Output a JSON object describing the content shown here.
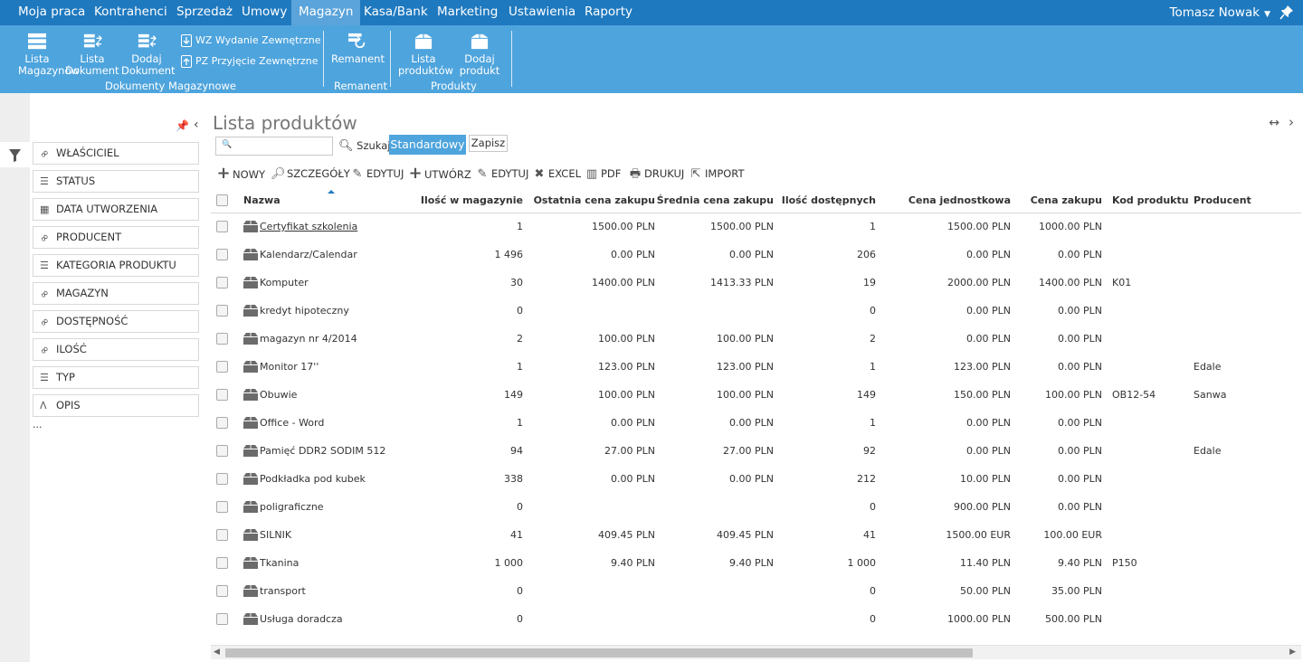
{
  "topnav": {
    "items": [
      "Moja praca",
      "Kontrahenci",
      "Sprzedaż",
      "Umowy",
      "Magazyn",
      "Kasa/Bank",
      "Marketing",
      "Ustawienia",
      "Raporty"
    ],
    "active": "Magazyn",
    "user": "Tomasz Nowak"
  },
  "ribbon": {
    "lista_magazynow": "Lista Magazynów",
    "lista_dokumentow": "Lista Dokumentó",
    "dodaj_dokument": "Dodaj Dokument",
    "wz": "WZ Wydanie Zewnętrzne",
    "pz": "PZ Przyjęcie Zewnętrzne",
    "group_dokumenty": "Dokumenty Magazynowe",
    "remanent_btn": "Remanent",
    "group_remanent": "Remanent",
    "lista_produktow": "Lista produktów",
    "dodaj_produkt": "Dodaj produkt",
    "group_produkty": "Produkty"
  },
  "filters": {
    "items": [
      {
        "label": "WŁAŚCICIEL",
        "icon": "link-icon"
      },
      {
        "label": "STATUS",
        "icon": "list-icon"
      },
      {
        "label": "DATA UTWORZENIA",
        "icon": "calendar-icon"
      },
      {
        "label": "PRODUCENT",
        "icon": "link-icon"
      },
      {
        "label": "KATEGORIA PRODUKTU",
        "icon": "list-icon"
      },
      {
        "label": "MAGAZYN",
        "icon": "link-icon"
      },
      {
        "label": "DOSTĘPNOŚĆ",
        "icon": "link-icon"
      },
      {
        "label": "ILOŚĆ",
        "icon": "link-icon"
      },
      {
        "label": "TYP",
        "icon": "list-icon"
      },
      {
        "label": "OPIS",
        "icon": "text-icon"
      }
    ],
    "more": "..."
  },
  "main": {
    "title": "Lista produktów",
    "search_value": "",
    "search_label": "Szukaj",
    "view_label": "Standardowy",
    "save_label": "Zapisz"
  },
  "toolbar": {
    "nowy": "NOWY",
    "szczegoly": "SZCZEGÓŁY",
    "edytuj1": "EDYTUJ",
    "utworz": "UTWÓRZ",
    "edytuj2": "EDYTUJ",
    "excel": "EXCEL",
    "pdf": "PDF",
    "drukuj": "DRUKUJ",
    "import": "IMPORT"
  },
  "table": {
    "headers": [
      "Nazwa",
      "Ilość w magazynie",
      "Ostatnia cena zakupu",
      "Średnia cena zakupu",
      "Ilość dostępnych",
      "Cena jednostkowa",
      "Cena zakupu",
      "Kod produktu",
      "Producent"
    ],
    "rows": [
      [
        "Certyfikat szkolenia",
        "1",
        "1500.00 PLN",
        "1500.00 PLN",
        "1",
        "1500.00 PLN",
        "1000.00 PLN",
        "",
        ""
      ],
      [
        "Kalendarz/Calendar",
        "1 496",
        "0.00 PLN",
        "0.00 PLN",
        "206",
        "0.00 PLN",
        "0.00 PLN",
        "",
        ""
      ],
      [
        "Komputer",
        "30",
        "1400.00 PLN",
        "1413.33 PLN",
        "19",
        "2000.00 PLN",
        "1400.00 PLN",
        "K01",
        ""
      ],
      [
        "kredyt hipoteczny",
        "0",
        "",
        "",
        "0",
        "0.00 PLN",
        "0.00 PLN",
        "",
        ""
      ],
      [
        "magazyn nr 4/2014",
        "2",
        "100.00 PLN",
        "100.00 PLN",
        "2",
        "0.00 PLN",
        "0.00 PLN",
        "",
        ""
      ],
      [
        "Monitor 17''",
        "1",
        "123.00 PLN",
        "123.00 PLN",
        "1",
        "123.00 PLN",
        "0.00 PLN",
        "",
        "Edale"
      ],
      [
        "Obuwie",
        "149",
        "100.00 PLN",
        "100.00 PLN",
        "149",
        "150.00 PLN",
        "100.00 PLN",
        "OB12-54",
        "Sanwa"
      ],
      [
        "Office - Word",
        "1",
        "0.00 PLN",
        "0.00 PLN",
        "1",
        "0.00 PLN",
        "0.00 PLN",
        "",
        ""
      ],
      [
        "Pamięć DDR2 SODIM 512",
        "94",
        "27.00 PLN",
        "27.00 PLN",
        "92",
        "0.00 PLN",
        "0.00 PLN",
        "",
        "Edale"
      ],
      [
        "Podkładka pod kubek",
        "338",
        "0.00 PLN",
        "0.00 PLN",
        "212",
        "10.00 PLN",
        "0.00 PLN",
        "",
        ""
      ],
      [
        "poligraficzne",
        "0",
        "",
        "",
        "0",
        "900.00 PLN",
        "0.00 PLN",
        "",
        ""
      ],
      [
        "SILNIK",
        "41",
        "409.45 PLN",
        "409.45 PLN",
        "41",
        "1500.00 EUR",
        "100.00 EUR",
        "",
        ""
      ],
      [
        "Tkanina",
        "1 000",
        "9.40 PLN",
        "9.40 PLN",
        "1 000",
        "11.40 PLN",
        "9.40 PLN",
        "P150",
        ""
      ],
      [
        "transport",
        "0",
        "",
        "",
        "0",
        "50.00 PLN",
        "35.00 PLN",
        "",
        ""
      ],
      [
        "Usługa doradcza",
        "0",
        "",
        "",
        "0",
        "1000.00 PLN",
        "500.00 PLN",
        "",
        ""
      ]
    ]
  },
  "scrollbar": {
    "position_fraction": 0.0,
    "visible_fraction": 0.69
  }
}
